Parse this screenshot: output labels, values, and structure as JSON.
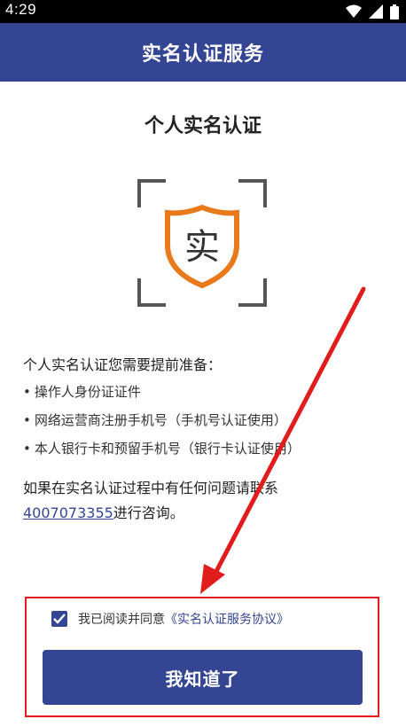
{
  "status": {
    "time": "4:29"
  },
  "appbar": {
    "title": "实名认证服务"
  },
  "main": {
    "heading": "个人实名认证",
    "emblem_char": "实",
    "intro": "个人实名认证您需要提前准备：",
    "bullet": "•",
    "requirements": [
      "操作人身份证证件",
      "网络运营商注册手机号（手机号认证使用）",
      "本人银行卡和预留手机号（银行卡认证使用）"
    ],
    "help_line1": "如果在实名认证过程中有任何问题请联系",
    "help_phone": "4007073355",
    "help_suffix": "进行咨询。"
  },
  "agreement": {
    "checked": true,
    "text": "我已阅读并同意",
    "link": "《实名认证服务协议》"
  },
  "confirm_button": {
    "label": "我知道了"
  },
  "colors": {
    "primary": "#344693",
    "accent_orange": "#e87a1c",
    "annotation_red": "#e01c1c"
  },
  "icons": [
    "wifi-icon",
    "signal-icon",
    "battery-icon",
    "check-icon",
    "shield-icon"
  ]
}
